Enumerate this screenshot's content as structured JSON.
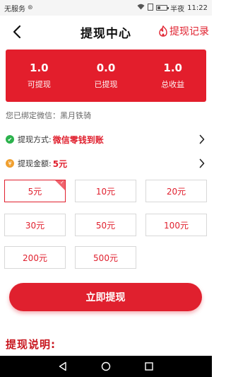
{
  "status_bar": {
    "carrier": "无服务",
    "carrier_badge": "⊛",
    "time_prefix": "半夜",
    "time": "11:22",
    "battery_level": 0.3
  },
  "nav": {
    "title": "提现中心",
    "record_label": "提现记录",
    "back_icon": "chevron-left-icon",
    "record_icon": "flame-icon"
  },
  "stats": [
    {
      "value": "1.0",
      "label": "可提现"
    },
    {
      "value": "0.0",
      "label": "已提现"
    },
    {
      "value": "1.0",
      "label": "总收益"
    }
  ],
  "bind_info": "您已绑定微信：黑月铁骑",
  "method": {
    "label": "提现方式:",
    "value": "微信零钱到账",
    "icon": "check-circle-icon"
  },
  "amount": {
    "label": "提现金额:",
    "value": "5元",
    "icon": "yen-circle-icon"
  },
  "amount_options": [
    "5元",
    "10元",
    "20元",
    "30元",
    "50元",
    "100元",
    "200元",
    "500元"
  ],
  "selected_amount_index": 0,
  "submit_label": "立即提现",
  "explain_title": "提现说明:",
  "colors": {
    "primary_red": "#e31e2c",
    "text_red": "#e0202e",
    "green": "#2bb24c",
    "orange": "#f0a030"
  }
}
